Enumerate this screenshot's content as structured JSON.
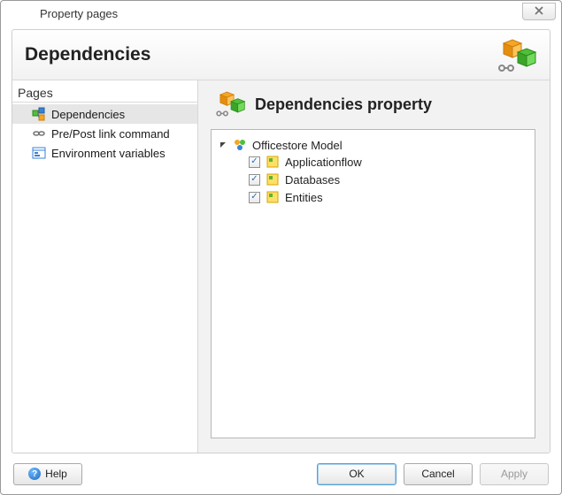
{
  "window": {
    "title": "Property pages"
  },
  "header": {
    "title": "Dependencies"
  },
  "sidebar": {
    "title": "Pages",
    "items": [
      {
        "label": "Dependencies",
        "icon": "dependencies-icon",
        "selected": true
      },
      {
        "label": "Pre/Post link command",
        "icon": "link-icon",
        "selected": false
      },
      {
        "label": "Environment variables",
        "icon": "env-icon",
        "selected": false
      }
    ]
  },
  "content": {
    "title": "Dependencies property",
    "tree": {
      "root": {
        "label": "Officestore Model",
        "expanded": true
      },
      "children": [
        {
          "label": "Applicationflow",
          "checked": true
        },
        {
          "label": "Databases",
          "checked": true
        },
        {
          "label": "Entities",
          "checked": true
        }
      ]
    }
  },
  "footer": {
    "help": "Help",
    "ok": "OK",
    "cancel": "Cancel",
    "apply": "Apply"
  }
}
